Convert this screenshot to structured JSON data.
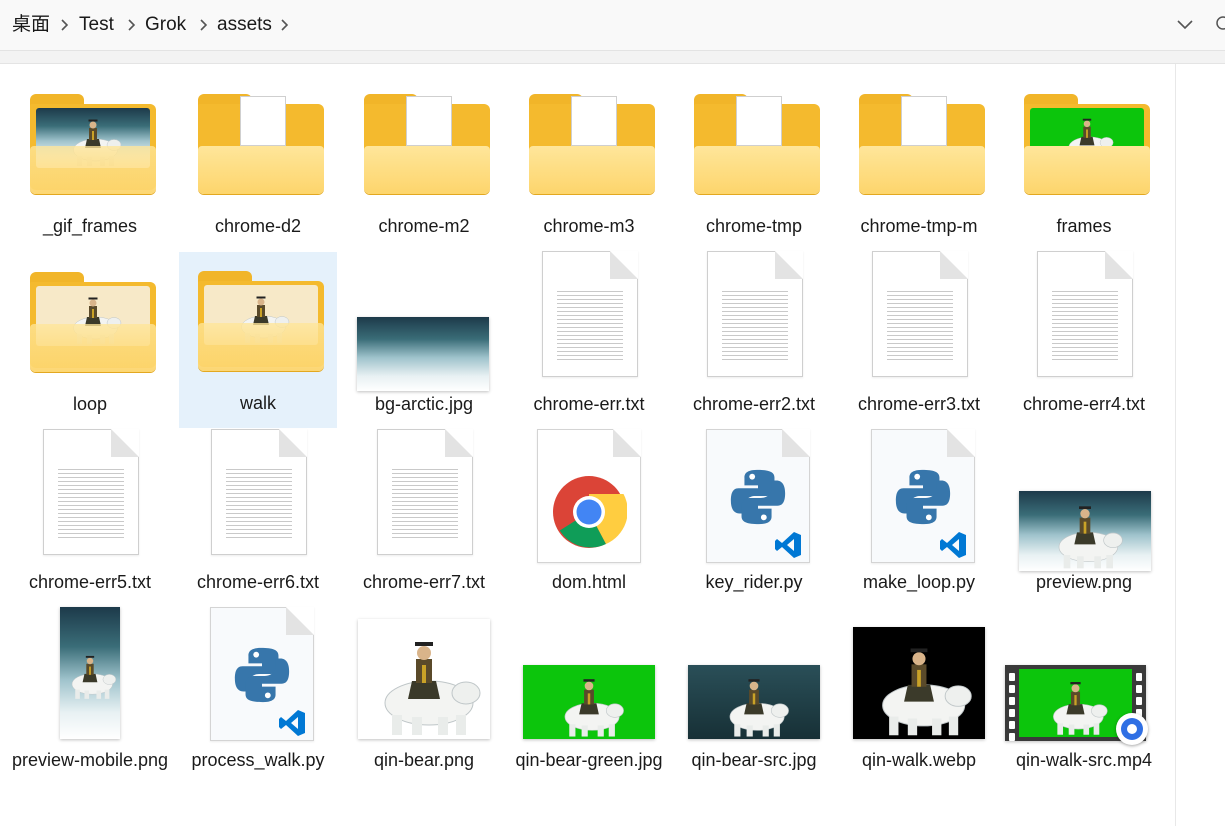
{
  "breadcrumb": [
    "桌面",
    "Test",
    "Grok",
    "assets"
  ],
  "icons": {
    "separator": "chevron-right-icon",
    "dropdown": "chevron-down-icon",
    "search": "search-icon"
  },
  "colors": {
    "selection": "#e5f1fb",
    "folder": "#f4ba2e",
    "green_screen": "#0cc50c",
    "python_blue": "#3776ab",
    "vscode_blue": "#0078d4"
  },
  "items": [
    {
      "name": "_gif_frames",
      "type": "folder",
      "thumb": "arctic"
    },
    {
      "name": "chrome-d2",
      "type": "folder",
      "thumb": "document"
    },
    {
      "name": "chrome-m2",
      "type": "folder",
      "thumb": "document"
    },
    {
      "name": "chrome-m3",
      "type": "folder",
      "thumb": "document"
    },
    {
      "name": "chrome-tmp",
      "type": "folder",
      "thumb": "document"
    },
    {
      "name": "chrome-tmp-m",
      "type": "folder",
      "thumb": "document"
    },
    {
      "name": "frames",
      "type": "folder",
      "thumb": "green"
    },
    {
      "name": "loop",
      "type": "folder",
      "thumb": "rider"
    },
    {
      "name": "walk",
      "type": "folder",
      "thumb": "rider",
      "selected": true
    },
    {
      "name": "bg-arctic.jpg",
      "type": "image",
      "thumb": "arctic"
    },
    {
      "name": "chrome-err.txt",
      "type": "text"
    },
    {
      "name": "chrome-err2.txt",
      "type": "text"
    },
    {
      "name": "chrome-err3.txt",
      "type": "text"
    },
    {
      "name": "chrome-err4.txt",
      "type": "text"
    },
    {
      "name": "chrome-err5.txt",
      "type": "text"
    },
    {
      "name": "chrome-err6.txt",
      "type": "text"
    },
    {
      "name": "chrome-err7.txt",
      "type": "text"
    },
    {
      "name": "dom.html",
      "type": "html"
    },
    {
      "name": "key_rider.py",
      "type": "python"
    },
    {
      "name": "make_loop.py",
      "type": "python"
    },
    {
      "name": "preview.png",
      "type": "image",
      "thumb": "arctic-rider"
    },
    {
      "name": "preview-mobile.png",
      "type": "image",
      "thumb": "mobile"
    },
    {
      "name": "process_walk.py",
      "type": "python"
    },
    {
      "name": "qin-bear.png",
      "type": "image",
      "thumb": "white"
    },
    {
      "name": "qin-bear-green.jpg",
      "type": "image",
      "thumb": "green"
    },
    {
      "name": "qin-bear-src.jpg",
      "type": "image",
      "thumb": "teal"
    },
    {
      "name": "qin-walk.webp",
      "type": "image",
      "thumb": "black"
    },
    {
      "name": "qin-walk-src.mp4",
      "type": "video",
      "thumb": "green"
    }
  ]
}
